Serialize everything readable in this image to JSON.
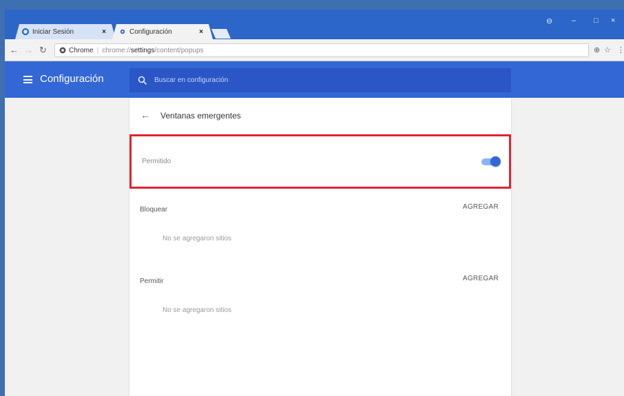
{
  "browser": {
    "tabs": [
      {
        "title": "Iniciar Sesión",
        "close": "×",
        "active": false
      },
      {
        "title": "Configuración",
        "close": "×",
        "active": true
      }
    ],
    "window_controls": {
      "profile": "⊖",
      "minimize": "–",
      "maximize": "□",
      "close": "×"
    },
    "url": {
      "site_name": "Chrome",
      "scheme": "chrome://",
      "host": "settings",
      "path": "/content/popups"
    },
    "nav": {
      "back": "←",
      "forward": "→",
      "reload": "↻"
    },
    "toolbar": {
      "zoom": "⊕",
      "star": "☆",
      "menu": "⋮"
    }
  },
  "settings": {
    "title": "Configuración",
    "search_placeholder": "Buscar en configuración"
  },
  "page": {
    "title": "Ventanas emergentes",
    "allowed_label": "Permitido",
    "allowed_on": true,
    "block": {
      "label": "Bloquear",
      "add": "AGREGAR",
      "empty": "No se agregaron sitios"
    },
    "allow": {
      "label": "Permitir",
      "add": "AGREGAR",
      "empty": "No se agregaron sitios"
    }
  },
  "colors": {
    "accent": "#3367d6",
    "highlight": "#e0242e",
    "titlebar": "#2b66c8"
  }
}
